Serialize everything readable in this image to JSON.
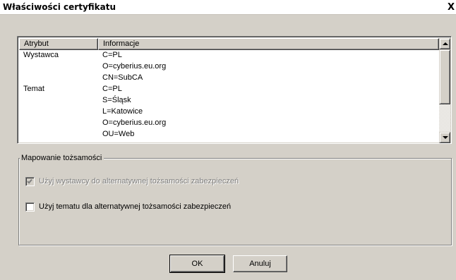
{
  "window": {
    "title": "Właściwości certyfikatu",
    "close_label": "X"
  },
  "listview": {
    "columns": [
      "Atrybut",
      "Informacje"
    ],
    "rows": [
      {
        "attr": "Wystawca",
        "value": "C=PL"
      },
      {
        "attr": "",
        "value": "O=cyberius.eu.org"
      },
      {
        "attr": "",
        "value": "CN=SubCA"
      },
      {
        "attr": "Temat",
        "value": "C=PL"
      },
      {
        "attr": "",
        "value": "S=Śląsk"
      },
      {
        "attr": "",
        "value": "L=Katowice"
      },
      {
        "attr": "",
        "value": "O=cyberius.eu.org"
      },
      {
        "attr": "",
        "value": "OU=Web"
      }
    ]
  },
  "identity_mapping": {
    "group_label": "Mapowanie tożsamości",
    "use_issuer": {
      "label": "Użyj wystawcy do alternatywnej tożsamości zabezpieczeń",
      "checked": true,
      "enabled": false
    },
    "use_subject": {
      "label": "Użyj tematu dla alternatywnej tożsamości zabezpieczeń",
      "checked": false,
      "enabled": true
    }
  },
  "buttons": {
    "ok_label": "OK",
    "cancel_label": "Anuluj"
  },
  "colors": {
    "face": "#d4d0c8",
    "shadow": "#808080",
    "highlight": "#ffffff"
  }
}
